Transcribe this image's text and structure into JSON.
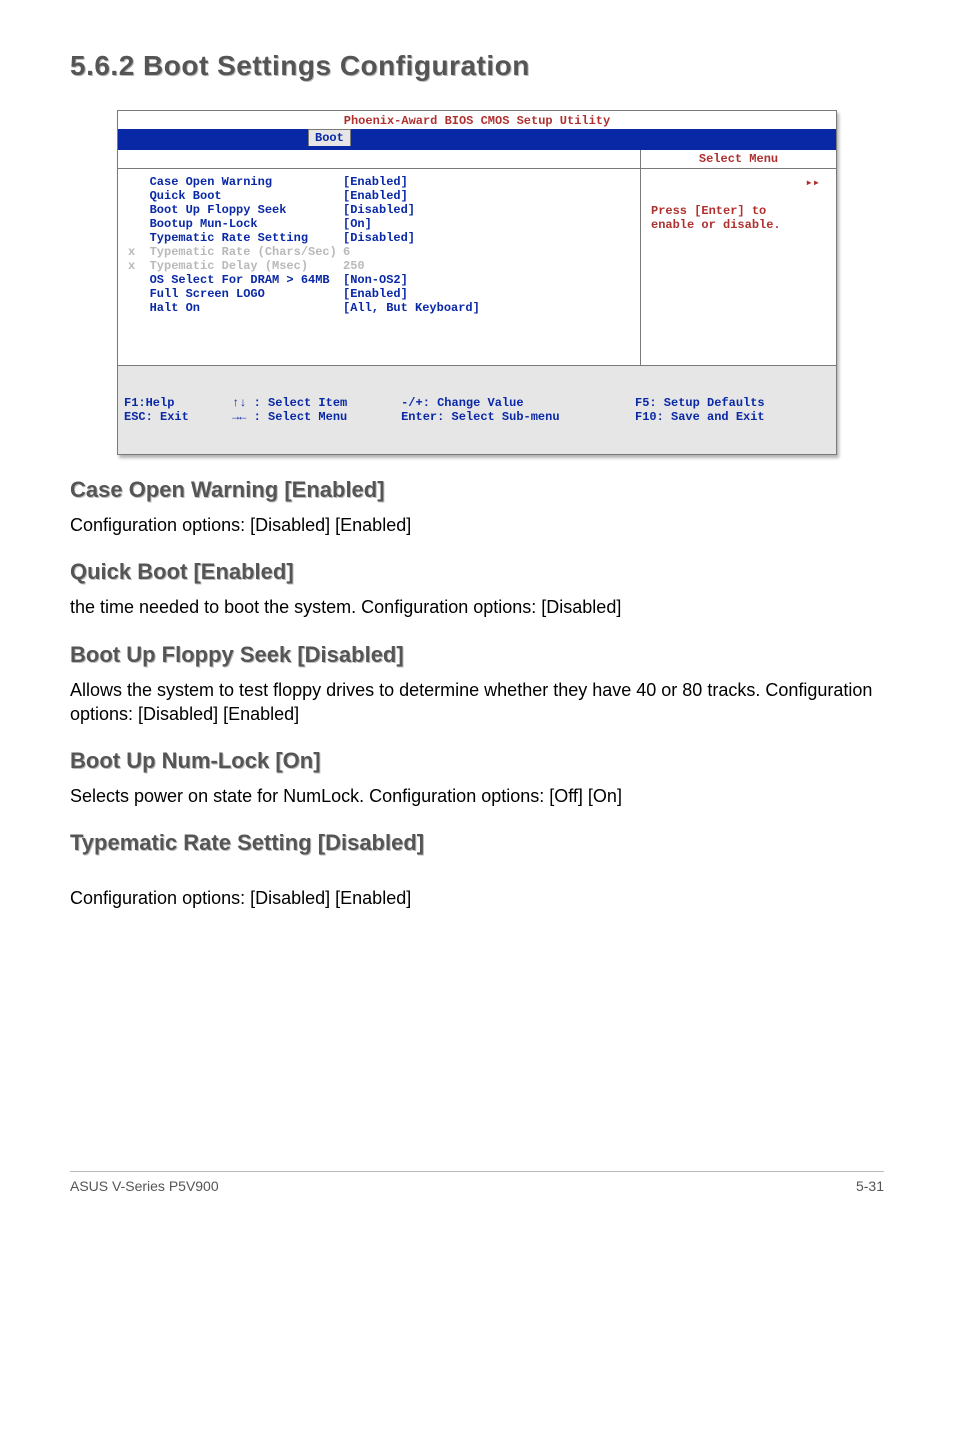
{
  "section_title": "5.6.2   Boot Settings Configuration",
  "bios": {
    "title": "Phoenix-Award BIOS CMOS Setup Utility",
    "tab": "Boot",
    "select_menu": "Select Menu",
    "help_arrow": "▸▸",
    "help_line1": "Press [Enter] to",
    "help_line2": "enable or disable.",
    "items": [
      {
        "k": "   Case Open Warning",
        "v": "[Enabled]",
        "dim": false
      },
      {
        "k": "   Quick Boot",
        "v": "[Enabled]",
        "dim": false
      },
      {
        "k": "   Boot Up Floppy Seek",
        "v": "[Disabled]",
        "dim": false
      },
      {
        "k": "   Bootup Mun-Lock",
        "v": "[On]",
        "dim": false
      },
      {
        "k": "   Typematic Rate Setting",
        "v": "[Disabled]",
        "dim": false
      },
      {
        "k": "x  Typematic Rate (Chars/Sec)",
        "v": "6",
        "dim": true
      },
      {
        "k": "x  Typematic Delay (Msec)",
        "v": "250",
        "dim": true
      },
      {
        "k": "   OS Select For DRAM > 64MB",
        "v": "[Non-OS2]",
        "dim": false
      },
      {
        "k": "   Full Screen LOGO",
        "v": "[Enabled]",
        "dim": false
      },
      {
        "k": "   Halt On",
        "v": "[All, But Keyboard]",
        "dim": false
      }
    ],
    "foot": {
      "c1a": "F1:Help        ↑↓ : Select Item",
      "c1b": "ESC: Exit      →← : Select Menu",
      "c2a": "   -/+: Change Value",
      "c2b": "   Enter: Select Sub-menu",
      "c3a": "F5: Setup Defaults",
      "c3b": "F10: Save and Exit"
    }
  },
  "h_case": "Case Open Warning [Enabled]",
  "p_case": "Configuration options: [Disabled] [Enabled]",
  "h_quick": "Quick Boot [Enabled]",
  "p_quick": "the time needed to boot the system. Configuration options: [Disabled]",
  "h_floppy": "Boot Up Floppy Seek [Disabled]",
  "p_floppy": "Allows the system to test floppy drives to determine whether they have 40 or 80 tracks. Configuration options: [Disabled] [Enabled]",
  "h_num": "Boot Up Num-Lock [On]",
  "p_num": "Selects power on state for NumLock. Configuration options: [Off] [On]",
  "h_typ": "Typematic Rate Setting [Disabled]",
  "p_typ": "Configuration options: [Disabled] [Enabled]",
  "footer_left": "ASUS V-Series P5V900",
  "footer_right": "5-31"
}
